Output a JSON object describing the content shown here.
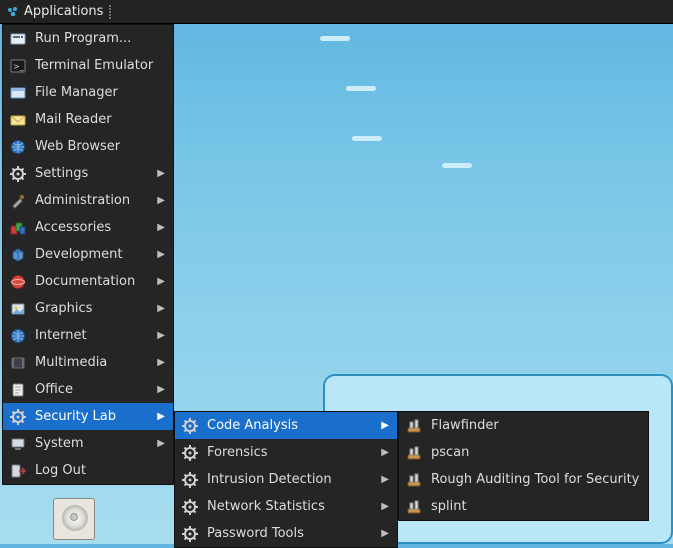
{
  "panel": {
    "title": "Applications"
  },
  "root_menu": [
    {
      "icon": "run-icon",
      "label": "Run Program...",
      "sub": false
    },
    {
      "icon": "terminal-icon",
      "label": "Terminal Emulator",
      "sub": false
    },
    {
      "icon": "files-icon",
      "label": "File Manager",
      "sub": false
    },
    {
      "icon": "mail-icon",
      "label": "Mail Reader",
      "sub": false
    },
    {
      "icon": "globe-icon",
      "label": "Web Browser",
      "sub": false
    },
    {
      "icon": "gear-icon",
      "label": "Settings",
      "sub": true
    },
    {
      "icon": "admin-icon",
      "label": "Administration",
      "sub": true
    },
    {
      "icon": "accessories-icon",
      "label": "Accessories",
      "sub": true
    },
    {
      "icon": "dev-icon",
      "label": "Development",
      "sub": true
    },
    {
      "icon": "doc-icon",
      "label": "Documentation",
      "sub": true
    },
    {
      "icon": "graphics-icon",
      "label": "Graphics",
      "sub": true
    },
    {
      "icon": "internet-icon",
      "label": "Internet",
      "sub": true
    },
    {
      "icon": "media-icon",
      "label": "Multimedia",
      "sub": true
    },
    {
      "icon": "office-icon",
      "label": "Office",
      "sub": true
    },
    {
      "icon": "gear-icon",
      "label": "Security Lab",
      "sub": true,
      "highlight": true
    },
    {
      "icon": "system-icon",
      "label": "System",
      "sub": true
    },
    {
      "icon": "logout-icon",
      "label": "Log Out",
      "sub": false
    }
  ],
  "security_menu": [
    {
      "icon": "gear-icon",
      "label": "Code Analysis",
      "sub": true,
      "highlight": true
    },
    {
      "icon": "gear-icon",
      "label": "Forensics",
      "sub": true
    },
    {
      "icon": "gear-icon",
      "label": "Intrusion Detection",
      "sub": true
    },
    {
      "icon": "gear-icon",
      "label": "Network Statistics",
      "sub": true
    },
    {
      "icon": "gear-icon",
      "label": "Password Tools",
      "sub": true
    }
  ],
  "code_menu": [
    {
      "icon": "tool-icon",
      "label": "Flawfinder"
    },
    {
      "icon": "tool-icon",
      "label": "pscan"
    },
    {
      "icon": "tool-icon",
      "label": "Rough Auditing Tool for Security"
    },
    {
      "icon": "tool-icon",
      "label": "splint"
    }
  ],
  "colors": {
    "panel_bg": "#222221",
    "menu_bg": "#252525",
    "highlight": "#1a6fcc"
  }
}
